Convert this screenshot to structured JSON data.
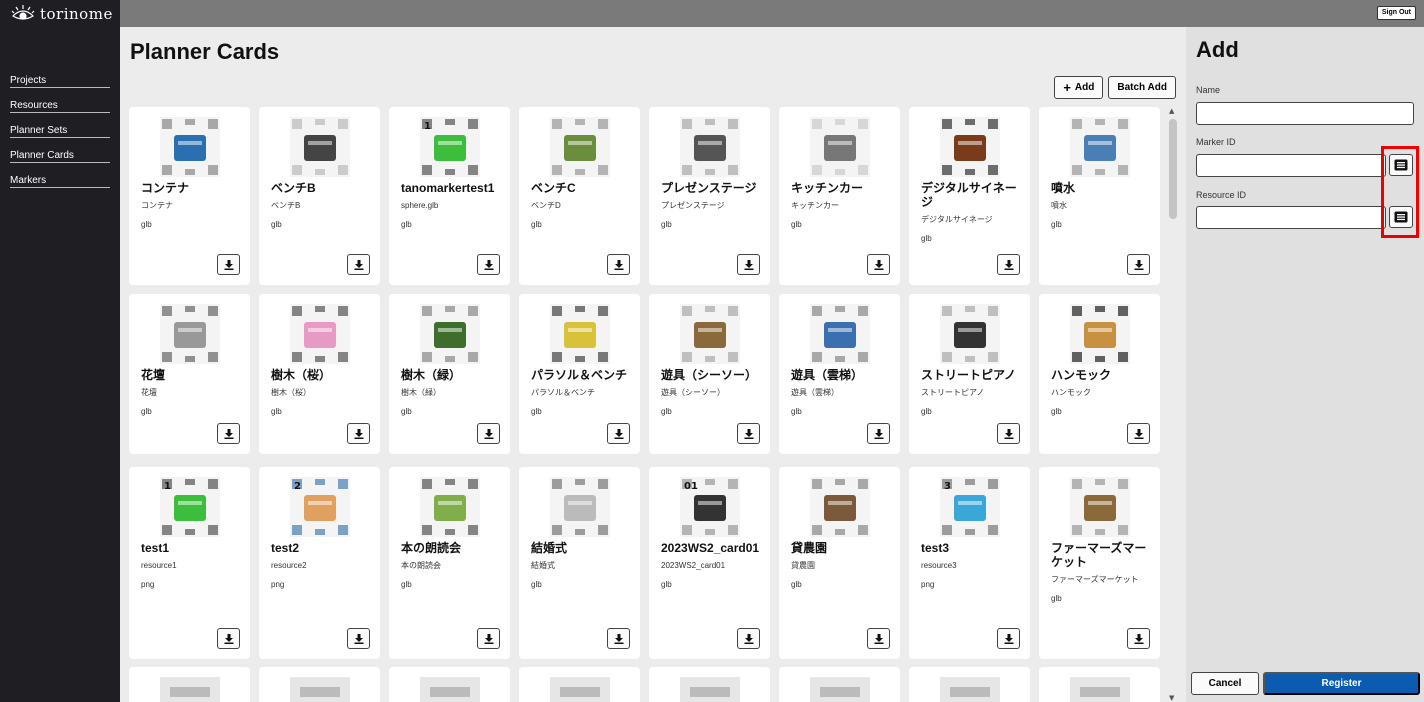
{
  "app": {
    "logo_text": "torinome",
    "sign_out": "Sign Out"
  },
  "sidebar": {
    "items": [
      {
        "label": "Projects"
      },
      {
        "label": "Resources"
      },
      {
        "label": "Planner Sets"
      },
      {
        "label": "Planner Cards"
      },
      {
        "label": "Markers"
      }
    ]
  },
  "main": {
    "title": "Planner Cards",
    "add_label": "Add",
    "batch_add_label": "Batch Add"
  },
  "cards": [
    {
      "name": "コンテナ",
      "resource": "コンテナ",
      "type": "glb"
    },
    {
      "name": "ベンチB",
      "resource": "ベンチB",
      "type": "glb"
    },
    {
      "name": "tanomarkertest1",
      "resource": "sphere.glb",
      "type": "glb"
    },
    {
      "name": "ベンチC",
      "resource": "ベンチD",
      "type": "glb"
    },
    {
      "name": "プレゼンステージ",
      "resource": "プレゼンステージ",
      "type": "glb"
    },
    {
      "name": "キッチンカー",
      "resource": "キッチンカー",
      "type": "glb"
    },
    {
      "name": "デジタルサイネージ",
      "resource": "デジタルサイネージ",
      "type": "glb"
    },
    {
      "name": "噴水",
      "resource": "噴水",
      "type": "glb"
    },
    {
      "name": "花壇",
      "resource": "花壇",
      "type": "glb"
    },
    {
      "name": "樹木（桜）",
      "resource": "樹木（桜）",
      "type": "glb"
    },
    {
      "name": "樹木（緑）",
      "resource": "樹木（緑）",
      "type": "glb"
    },
    {
      "name": "パラソル＆ベンチ",
      "resource": "パラソル＆ベンチ",
      "type": "glb"
    },
    {
      "name": "遊具（シーソー）",
      "resource": "遊具（シーソー）",
      "type": "glb"
    },
    {
      "name": "遊具（雲梯）",
      "resource": "遊具（雲梯）",
      "type": "glb"
    },
    {
      "name": "ストリートピアノ",
      "resource": "ストリートピアノ",
      "type": "glb"
    },
    {
      "name": "ハンモック",
      "resource": "ハンモック",
      "type": "glb"
    },
    {
      "name": "test1",
      "resource": "resource1",
      "type": "png"
    },
    {
      "name": "test2",
      "resource": "resource2",
      "type": "png"
    },
    {
      "name": "本の朗読会",
      "resource": "本の朗読会",
      "type": "glb"
    },
    {
      "name": "結婚式",
      "resource": "結婚式",
      "type": "glb"
    },
    {
      "name": "2023WS2_card01",
      "resource": "2023WS2_card01",
      "type": "glb"
    },
    {
      "name": "貸農園",
      "resource": "貸農園",
      "type": "glb"
    },
    {
      "name": "test3",
      "resource": "resource3",
      "type": "png"
    },
    {
      "name": "ファーマーズマーケット",
      "resource": "ファーマーズマーケット",
      "type": "glb"
    }
  ],
  "thumb_badges": {
    "c2": "1",
    "c16": "1",
    "c17": "2",
    "c20": "01",
    "c22": "3"
  },
  "panel": {
    "title": "Add",
    "name_label": "Name",
    "marker_label": "Marker ID",
    "resource_label": "Resource ID",
    "cancel": "Cancel",
    "register": "Register"
  }
}
